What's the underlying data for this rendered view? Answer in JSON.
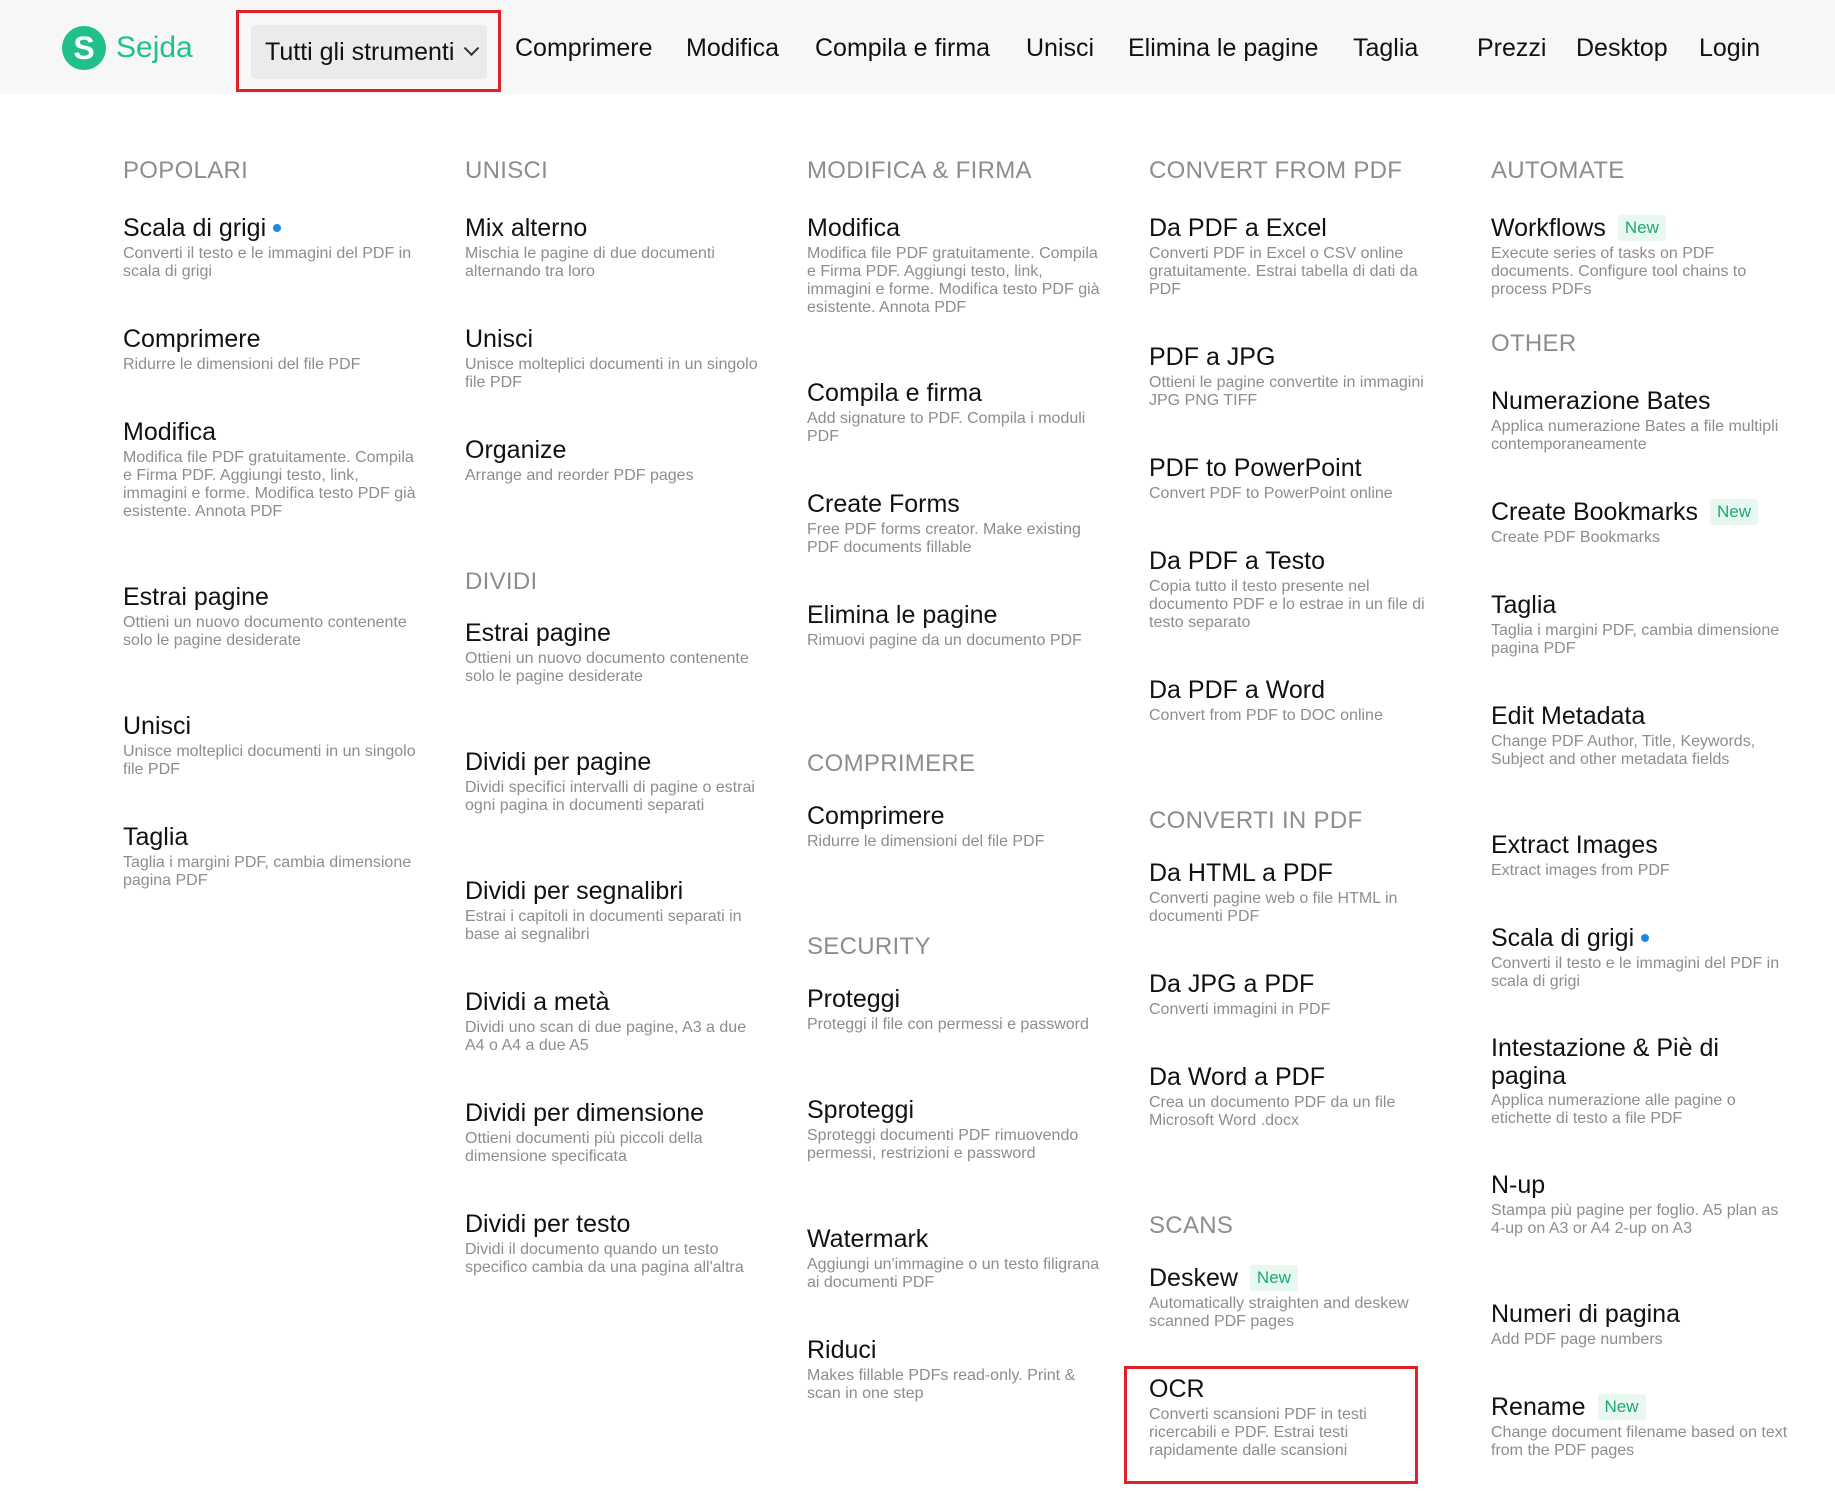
{
  "header": {
    "logo_text": "Sejda",
    "logo_letter": "S",
    "all_tools_label": "Tutti gli strumenti",
    "nav": [
      {
        "label": "Comprimere"
      },
      {
        "label": "Modifica"
      },
      {
        "label": "Compila e firma"
      },
      {
        "label": "Unisci"
      },
      {
        "label": "Elimina le pagine"
      },
      {
        "label": "Taglia"
      },
      {
        "label": "Prezzi"
      },
      {
        "label": "Desktop"
      },
      {
        "label": "Login"
      }
    ]
  },
  "badge_new": "New",
  "colors": {
    "brand": "#21c08b",
    "highlight": "#e0202a",
    "dot": "#1e88e5"
  },
  "columns": {
    "c1": {
      "popolari": {
        "title": "POPOLARI",
        "items": [
          {
            "name": "Scala di grigi",
            "desc": "Converti il testo e le immagini del PDF in scala di grigi"
          },
          {
            "name": "Comprimere",
            "desc": "Ridurre le dimensioni del file PDF"
          },
          {
            "name": "Modifica",
            "desc": "Modifica file PDF gratuitamente. Compila e Firma PDF. Aggiungi testo, link, immagini e forme. Modifica testo PDF già esistente. Annota PDF"
          },
          {
            "name": "Estrai pagine",
            "desc": "Ottieni un nuovo documento contenente solo le pagine desiderate"
          },
          {
            "name": "Unisci",
            "desc": "Unisce molteplici documenti in un singolo file PDF"
          },
          {
            "name": "Taglia",
            "desc": "Taglia i margini PDF, cambia dimensione pagina PDF"
          }
        ]
      }
    },
    "c2": {
      "unisci": {
        "title": "UNISCI",
        "items": [
          {
            "name": "Mix alterno",
            "desc": "Mischia le pagine di due documenti alternando tra loro"
          },
          {
            "name": "Unisci",
            "desc": "Unisce molteplici documenti in un singolo file PDF"
          },
          {
            "name": "Organize",
            "desc": "Arrange and reorder PDF pages"
          }
        ]
      },
      "dividi": {
        "title": "DIVIDI",
        "items": [
          {
            "name": "Estrai pagine",
            "desc": "Ottieni un nuovo documento contenente solo le pagine desiderate"
          },
          {
            "name": "Dividi per pagine",
            "desc": "Dividi specifici intervalli di pagine o estrai ogni pagina in documenti separati"
          },
          {
            "name": "Dividi per segnalibri",
            "desc": "Estrai i capitoli in documenti separati in base ai segnalibri"
          },
          {
            "name": "Dividi a metà",
            "desc": "Dividi uno scan di due pagine, A3 a due A4 o A4 a due A5"
          },
          {
            "name": "Dividi per dimensione",
            "desc": "Ottieni documenti più piccoli della dimensione specificata"
          },
          {
            "name": "Dividi per testo",
            "desc": "Dividi il documento quando un testo specifico cambia da una pagina all'altra"
          }
        ]
      }
    },
    "c3": {
      "modifica": {
        "title": "MODIFICA & FIRMA",
        "items": [
          {
            "name": "Modifica",
            "desc": "Modifica file PDF gratuitamente. Compila e Firma PDF. Aggiungi testo, link, immagini e forme. Modifica testo PDF già esistente. Annota PDF"
          },
          {
            "name": "Compila e firma",
            "desc": "Add signature to PDF. Compila i moduli PDF"
          },
          {
            "name": "Create Forms",
            "desc": "Free PDF forms creator. Make existing PDF documents fillable"
          },
          {
            "name": "Elimina le pagine",
            "desc": "Rimuovi pagine da un documento PDF"
          }
        ]
      },
      "comprimere": {
        "title": "COMPRIMERE",
        "items": [
          {
            "name": "Comprimere",
            "desc": "Ridurre le dimensioni del file PDF"
          }
        ]
      },
      "security": {
        "title": "SECURITY",
        "items": [
          {
            "name": "Proteggi",
            "desc": "Proteggi il file con permessi e password"
          },
          {
            "name": "Sproteggi",
            "desc": "Sproteggi documenti PDF rimuovendo permessi, restrizioni e password"
          },
          {
            "name": "Watermark",
            "desc": "Aggiungi un'immagine o un testo filigrana ai documenti PDF"
          },
          {
            "name": "Riduci",
            "desc": "Makes fillable PDFs read-only. Print & scan in one step"
          }
        ]
      }
    },
    "c4": {
      "convert_from": {
        "title": "CONVERT FROM PDF",
        "items": [
          {
            "name": "Da PDF a Excel",
            "desc": "Converti PDF in Excel o CSV online gratuitamente. Estrai tabella di dati da PDF"
          },
          {
            "name": "PDF a JPG",
            "desc": "Ottieni le pagine convertite in immagini JPG PNG TIFF"
          },
          {
            "name": "PDF to PowerPoint",
            "desc": "Convert PDF to PowerPoint online"
          },
          {
            "name": "Da PDF a Testo",
            "desc": "Copia tutto il testo presente nel documento PDF e lo estrae in un file di testo separato"
          },
          {
            "name": "Da PDF a Word",
            "desc": "Convert from PDF to DOC online"
          }
        ]
      },
      "convert_to": {
        "title": "CONVERTI IN PDF",
        "items": [
          {
            "name": "Da HTML a PDF",
            "desc": "Converti pagine web o file HTML in documenti PDF"
          },
          {
            "name": "Da JPG a PDF",
            "desc": "Converti immagini in PDF"
          },
          {
            "name": "Da Word a PDF",
            "desc": "Crea un documento PDF da un file Microsoft Word .docx"
          }
        ]
      },
      "scans": {
        "title": "SCANS",
        "items": [
          {
            "name": "Deskew",
            "desc": "Automatically straighten and deskew scanned PDF pages"
          },
          {
            "name": "OCR",
            "desc": "Converti scansioni PDF in testi ricercabili e PDF. Estrai testi rapidamente dalle scansioni"
          }
        ]
      }
    },
    "c5": {
      "automate": {
        "title": "AUTOMATE",
        "items": [
          {
            "name": "Workflows",
            "desc": "Execute series of tasks on PDF documents. Configure tool chains to process PDFs"
          }
        ]
      },
      "other": {
        "title": "OTHER",
        "items": [
          {
            "name": "Numerazione Bates",
            "desc": "Applica numerazione Bates a file multipli contemporaneamente"
          },
          {
            "name": "Create Bookmarks",
            "desc": "Create PDF Bookmarks"
          },
          {
            "name": "Taglia",
            "desc": "Taglia i margini PDF, cambia dimensione pagina PDF"
          },
          {
            "name": "Edit Metadata",
            "desc": "Change PDF Author, Title, Keywords, Subject and other metadata fields"
          },
          {
            "name": "Extract Images",
            "desc": "Extract images from PDF"
          },
          {
            "name": "Scala di grigi",
            "desc": "Converti il testo e le immagini del PDF in scala di grigi"
          },
          {
            "name": "Intestazione & Piè di pagina",
            "desc": "Applica numerazione alle pagine o etichette di testo a file PDF"
          },
          {
            "name": "N-up",
            "desc": "Stampa più pagine per foglio. A5 plan as 4-up on A3 or A4 2-up on A3"
          },
          {
            "name": "Numeri di pagina",
            "desc": "Add PDF page numbers"
          },
          {
            "name": "Rename",
            "desc": "Change document filename based on text from the PDF pages"
          }
        ]
      }
    }
  }
}
